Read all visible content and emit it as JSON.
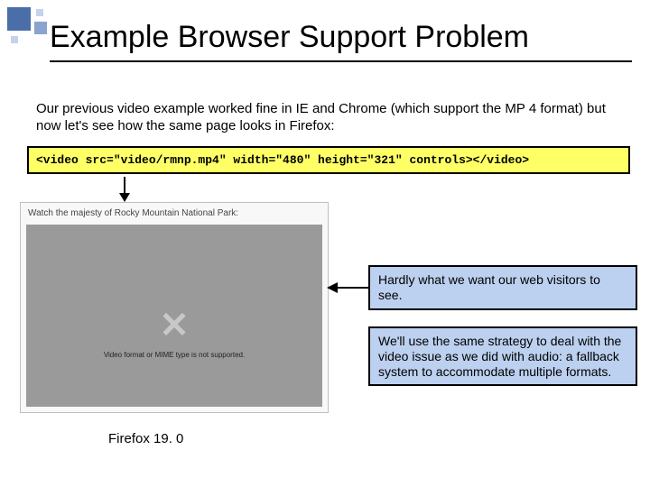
{
  "title": "Example Browser Support Problem",
  "intro": "Our previous video example worked fine in IE and Chrome (which support the MP 4 format) but now let's see how the same page looks in Firefox:",
  "code": "<video src=\"video/rmnp.mp4\" width=\"480\" height=\"321\" controls></video>",
  "browser": {
    "caption": "Watch the majesty of Rocky Mountain National Park:",
    "xmark": "✕",
    "error": "Video format or MIME type is not supported."
  },
  "callouts": {
    "one": "Hardly what we want our web visitors to see.",
    "two": "We'll use the same strategy to deal with the video issue as we did with audio: a fallback system to accommodate multiple formats."
  },
  "firefox_label": "Firefox 19. 0"
}
